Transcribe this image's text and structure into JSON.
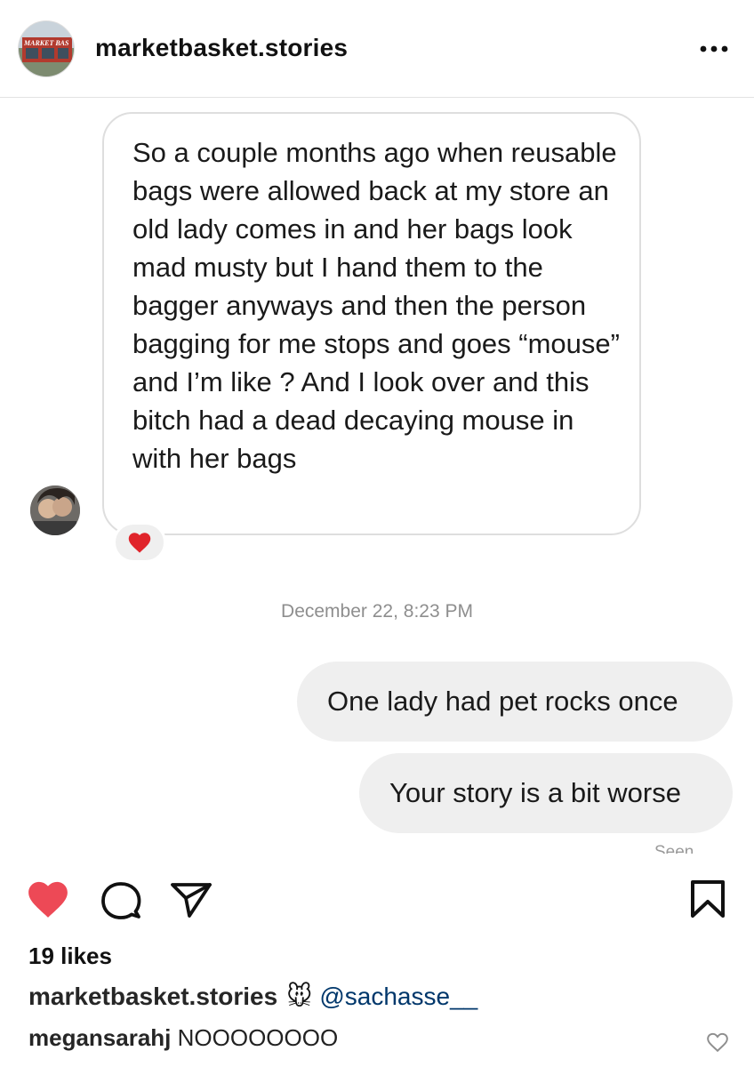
{
  "header": {
    "avatar_text": "MARKET BAS",
    "username": "marketbasket.stories",
    "more_icon": "more-horizontal-icon"
  },
  "conversation": {
    "incoming_message": "So a couple months ago when reusable bags were allowed back at my store an old lady comes in and her bags look mad musty but I hand them to the bagger anyways and then the person bagging for me stops and goes “mouse” and I’m like ? And I look over and this bitch had a dead decaying mouse in with her bags",
    "reaction_icon": "heart-reaction-icon",
    "timestamp": "December 22, 8:23 PM",
    "outgoing_messages": [
      "One lady had pet rocks once",
      "Your story is a bit worse"
    ],
    "seen_label": "Seen"
  },
  "actions": {
    "like_icon": "heart-filled-icon",
    "comment_icon": "comment-icon",
    "share_icon": "send-icon",
    "save_icon": "bookmark-icon",
    "like_color": "#ed4956"
  },
  "likes": "19 likes",
  "caption": {
    "username": "marketbasket.stories",
    "emoji": "🐭",
    "mention": "@sachasse__"
  },
  "comment": {
    "username": "megansarahj",
    "text": "NOOOOOOOO",
    "like_icon": "heart-outline-icon"
  }
}
